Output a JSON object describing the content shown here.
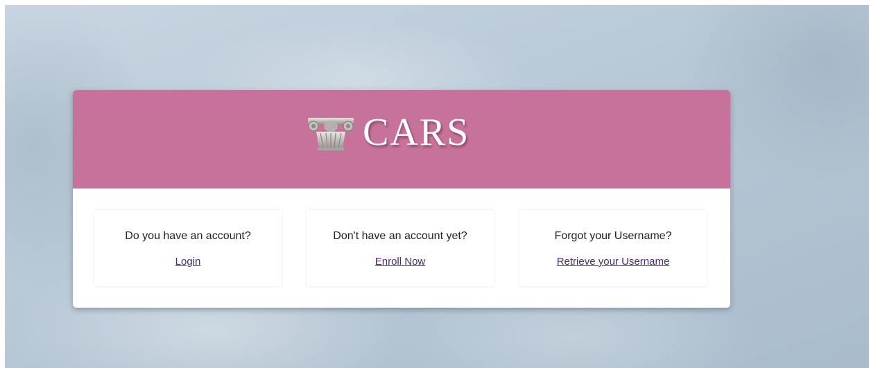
{
  "brand": {
    "name": "CARS",
    "logo_icon": "column-capital-icon",
    "banner_color": "#c7729a"
  },
  "panels": [
    {
      "question": "Do you have an account?",
      "link": "Login"
    },
    {
      "question": "Don't have an account yet?",
      "link": "Enroll Now"
    },
    {
      "question": "Forgot your Username?",
      "link": "Retrieve your Username"
    }
  ],
  "colors": {
    "link": "#4b2c74",
    "text": "#222222",
    "card": "#ffffff"
  }
}
